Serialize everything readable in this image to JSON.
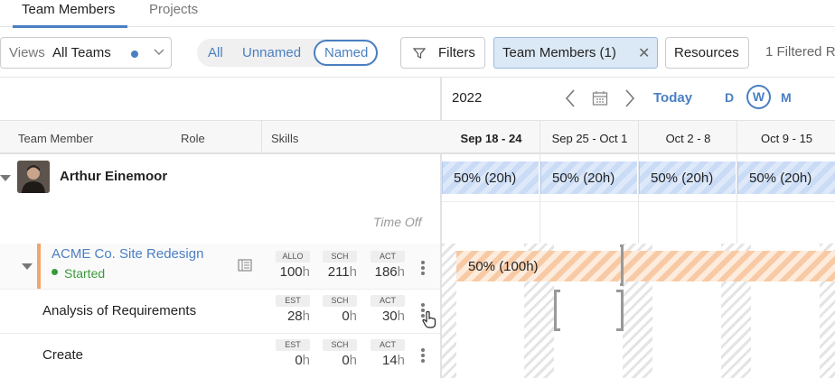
{
  "tabs": [
    {
      "label": "Team Members",
      "active": true
    },
    {
      "label": "Projects",
      "active": false
    }
  ],
  "toolbar": {
    "views_label": "Views",
    "views_value": "All Teams",
    "segments": [
      "All",
      "Unnamed",
      "Named"
    ],
    "selected_segment": "Named",
    "filters_label": "Filters",
    "chip_label": "Team Members (1)",
    "resources_label": "Resources",
    "filtered_text": "1 Filtered R"
  },
  "timeline": {
    "year": "2022",
    "today_label": "Today",
    "zoom_options": [
      "D",
      "W",
      "M"
    ],
    "zoom_selected": "W",
    "weeks": [
      "Sep 18 - 24",
      "Sep 25 - Oct 1",
      "Oct 2 - 8",
      "Oct 9 - 15"
    ],
    "current_week": "Sep 18 - 24"
  },
  "columns": {
    "member": "Team Member",
    "role": "Role",
    "skills": "Skills"
  },
  "member": {
    "name": "Arthur Einemoor",
    "time_off_label": "Time Off",
    "allocations": [
      "50% (20h)",
      "50% (20h)",
      "50% (20h)",
      "50% (20h)"
    ]
  },
  "project": {
    "name": "ACME Co. Site Redesign",
    "status": "Started",
    "allocation_label": "50% (100h)",
    "metrics": [
      {
        "label": "ALLO",
        "value": "100",
        "unit": "h"
      },
      {
        "label": "SCH",
        "value": "211",
        "unit": "h"
      },
      {
        "label": "ACT",
        "value": "186",
        "unit": "h"
      }
    ]
  },
  "tasks": [
    {
      "name": "Analysis of Requirements",
      "metrics": [
        {
          "label": "EST",
          "value": "28",
          "unit": "h"
        },
        {
          "label": "SCH",
          "value": "0",
          "unit": "h"
        },
        {
          "label": "ACT",
          "value": "30",
          "unit": "h"
        }
      ]
    },
    {
      "name": "Create",
      "metrics": [
        {
          "label": "EST",
          "value": "0",
          "unit": "h"
        },
        {
          "label": "SCH",
          "value": "0",
          "unit": "h"
        },
        {
          "label": "ACT",
          "value": "14",
          "unit": "h"
        }
      ]
    }
  ],
  "colors": {
    "accent": "#4a7fc1",
    "project_bar": "#f0a56f",
    "status_started": "#3a9a3a"
  }
}
